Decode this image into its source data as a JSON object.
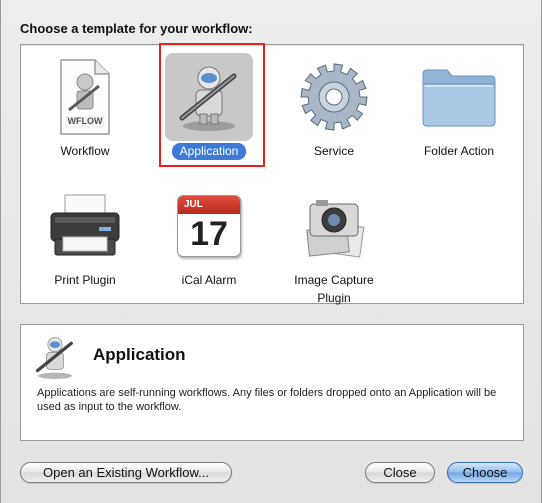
{
  "dialog": {
    "prompt": "Choose a template for your workflow:"
  },
  "templates": [
    {
      "label": "Workflow",
      "icon": "wflow-document-icon",
      "badge": "WFLOW"
    },
    {
      "label": "Application",
      "icon": "automator-robot-icon",
      "selected": true
    },
    {
      "label": "Service",
      "icon": "gear-icon"
    },
    {
      "label": "Folder Action",
      "icon": "folder-icon"
    },
    {
      "label": "Print Plugin",
      "icon": "printer-icon"
    },
    {
      "label": "iCal Alarm",
      "icon": "calendar-icon",
      "month": "JUL",
      "day": "17"
    },
    {
      "label": "Image Capture Plugin",
      "label_line1": "Image Capture",
      "label_line2": "Plugin",
      "icon": "camera-icon"
    }
  ],
  "description": {
    "title": "Application",
    "text": "Applications are self-running workflows. Any files or folders dropped onto an Application will be used as input to the workflow."
  },
  "buttons": {
    "open_existing": "Open an Existing Workflow...",
    "close": "Close",
    "choose": "Choose"
  },
  "colors": {
    "selection": "#3d7bd6",
    "highlight_box": "#e2231a"
  }
}
